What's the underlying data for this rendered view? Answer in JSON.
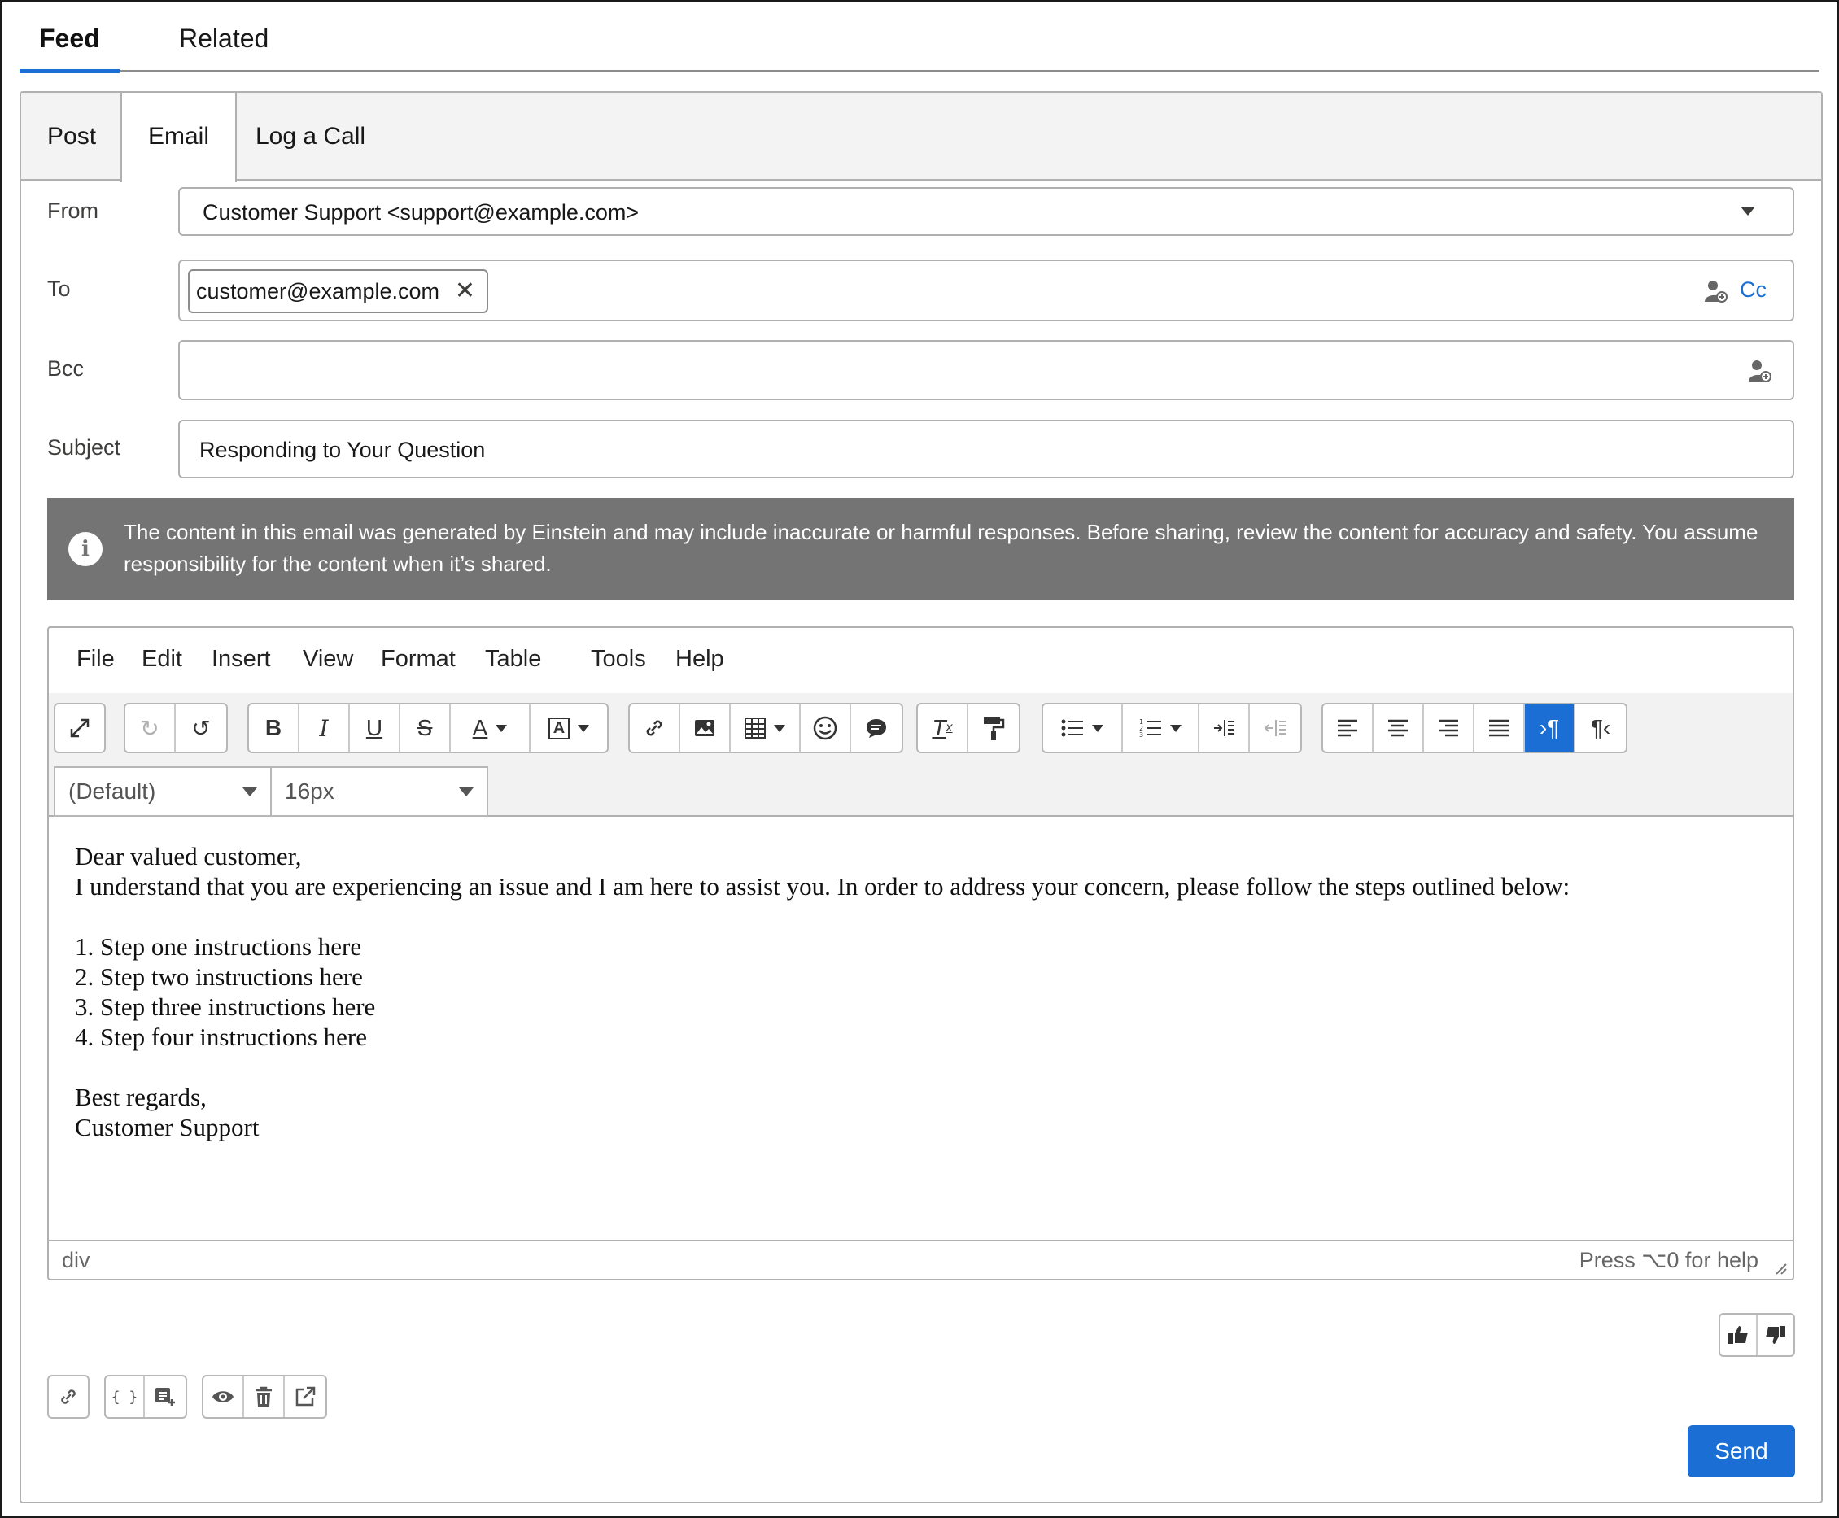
{
  "top_tabs": [
    {
      "label": "Feed"
    },
    {
      "label": "Related"
    }
  ],
  "sub_tabs": [
    {
      "label": "Post"
    },
    {
      "label": "Email"
    },
    {
      "label": "Log a Call"
    }
  ],
  "form": {
    "from_label": "From",
    "from_value": "Customer Support <support@example.com>",
    "to_label": "To",
    "to_recipient": "customer@example.com",
    "cc_link": "Cc",
    "bcc_label": "Bcc",
    "subject_label": "Subject",
    "subject_value": "Responding to Your Question"
  },
  "banner": {
    "text": "The content in this email was generated by Einstein and may include inaccurate or harmful responses. Before sharing, review the content for accuracy and safety. You assume responsibility for the content when it’s shared."
  },
  "editor": {
    "menu": [
      "File",
      "Edit",
      "Insert",
      "View",
      "Format",
      "Table",
      "Tools",
      "Help"
    ],
    "font_family": "(Default)",
    "font_size": "16px",
    "body": "Dear valued customer,\nI understand that you are experiencing an issue and I am here to assist you. In order to address your concern, please follow the steps outlined below:\n\n1. Step one instructions here\n2. Step two instructions here\n3. Step three instructions here\n4. Step four instructions here\n\nBest regards,\nCustomer Support",
    "status_path": "div",
    "status_help": "Press ⌥0 for help"
  },
  "actions": {
    "send_label": "Send",
    "merge_field_label": "{ }"
  },
  "colors": {
    "accent": "#1b6fd4",
    "banner_bg": "#747474",
    "toolbar_bg": "#f2f2f2"
  }
}
